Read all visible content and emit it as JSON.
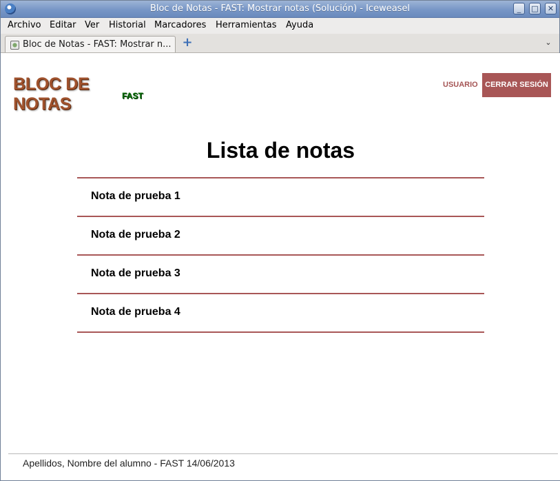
{
  "window": {
    "title": "Bloc de Notas - FAST: Mostrar notas (Solución) - Iceweasel",
    "controls": {
      "minimize": "_",
      "maximize": "□",
      "close": "✕"
    }
  },
  "menu": [
    "Archivo",
    "Editar",
    "Ver",
    "Historial",
    "Marcadores",
    "Herramientas",
    "Ayuda"
  ],
  "tabs": {
    "active_title": "Bloc de Notas - FAST: Mostrar n...",
    "new_tab_symbol": "+",
    "list_symbol": "⌄"
  },
  "header": {
    "logo_main": "BLOC DE NOTAS",
    "logo_sub": "FAST",
    "user_link": "USUARIO",
    "logout_label": "CERRAR SESIÓN"
  },
  "main": {
    "title": "Lista de notas",
    "notes": [
      "Nota de prueba 1",
      "Nota de prueba 2",
      "Nota de prueba 3",
      "Nota de prueba 4"
    ]
  },
  "footer": {
    "text": "Apellidos, Nombre del alumno - FAST 14/06/2013"
  },
  "colors": {
    "accent": "#a85656",
    "logo_brown": "#a0522d",
    "logo_green": "#0a6b0a",
    "titlebar": "#7796c6"
  }
}
